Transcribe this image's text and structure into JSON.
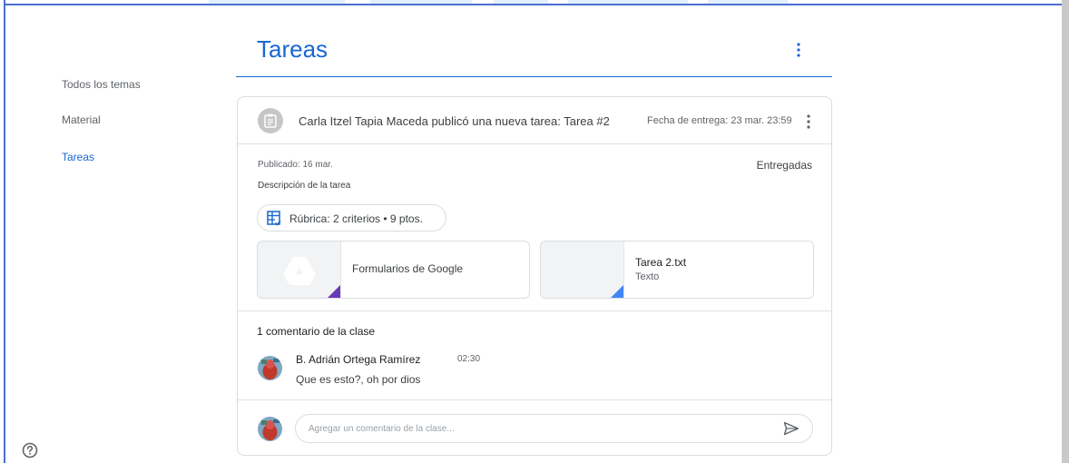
{
  "sidebar": {
    "items": [
      {
        "label": "Todos los temas"
      },
      {
        "label": "Material"
      },
      {
        "label": "Tareas"
      }
    ]
  },
  "header": {
    "title": "Tareas"
  },
  "post": {
    "title": "Carla Itzel Tapia Maceda publicó una nueva tarea: Tarea #2",
    "due": "Fecha de entrega: 23 mar. 23:59",
    "posted": "Publicado: 16 mar.",
    "status_link": "Entregadas",
    "description": "Descripción de la tarea",
    "rubric": "Rúbrica: 2 criterios • 9 ptos.",
    "attachments": [
      {
        "name": "Formularios de Google",
        "type": ""
      },
      {
        "name": "Tarea 2.txt",
        "type": "Texto"
      }
    ]
  },
  "comments": {
    "title": "1 comentario de la clase",
    "items": [
      {
        "author": "B. Adrián Ortega Ramírez",
        "time": "02:30",
        "text": "Que es esto?, oh por dios"
      }
    ],
    "input_placeholder": "Agregar un comentario de la clase..."
  },
  "colors": {
    "accent": "#1967d2",
    "forms_corner": "#673ab7",
    "text_corner": "#4285f4",
    "frame": "#4a6fd0"
  },
  "icons": {
    "assignment": "assignment-icon",
    "more": "more-vert-icon",
    "rubric": "rubric-icon",
    "drive": "google-drive-icon",
    "send": "send-icon",
    "help": "help-icon"
  }
}
